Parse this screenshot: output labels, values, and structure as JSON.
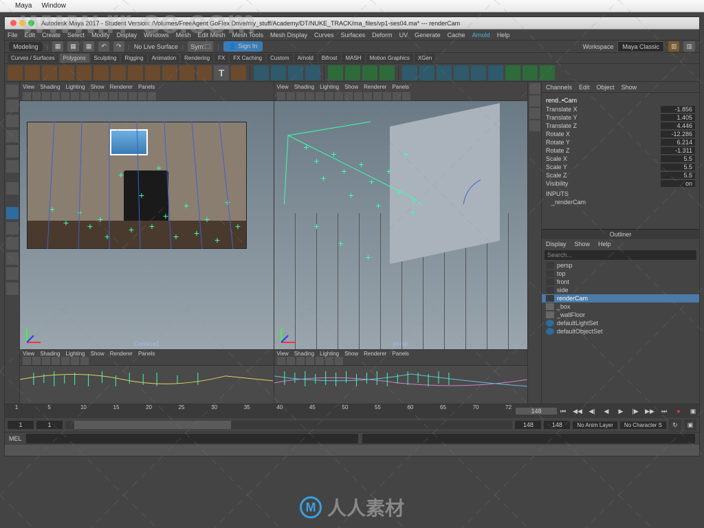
{
  "watermarks": {
    "url": "www.rr-sc.com",
    "brand": "人人素材"
  },
  "macMenu": [
    "Maya",
    "Window"
  ],
  "window": {
    "title": "Autodesk Maya 2017 - Student Version: /Volumes/FreeAgent GoFlex Drive/my_stuff/Academy/DT/NUKE_TRACK/ma_files/vp1-ses04.ma* --- renderCam"
  },
  "mainMenu": [
    "File",
    "Edit",
    "Create",
    "Select",
    "Modify",
    "Display",
    "Windows",
    "Mesh",
    "Edit Mesh",
    "Mesh Tools",
    "Mesh Display",
    "Curves",
    "Surfaces",
    "Deform",
    "UV",
    "Generate",
    "Cache",
    "Arnold",
    "Help"
  ],
  "statusLine": {
    "modeling": "Modeling",
    "noLive": "No Live Surface",
    "sym": "Sym:",
    "signIn": "Sign In",
    "workspace": "Workspace",
    "preset": "Maya Classic"
  },
  "shelfTabs": [
    "Curves / Surfaces",
    "Polygons",
    "Sculpting",
    "Rigging",
    "Animation",
    "Rendering",
    "FX",
    "FX Caching",
    "Custom",
    "Arnold",
    "Bifrost",
    "MASH",
    "Motion Graphics",
    "XGen"
  ],
  "viewportMenu": [
    "View",
    "Shading",
    "Lighting",
    "Show",
    "Renderer",
    "Panels"
  ],
  "viewLabels": {
    "v1": "Camera1",
    "v2": "persp"
  },
  "channelBox": {
    "tabs": [
      "Channels",
      "Edit",
      "Object",
      "Show"
    ],
    "objName": "rend..•Cam",
    "attrs": [
      {
        "n": "Translate X",
        "v": "-1.856"
      },
      {
        "n": "Translate Y",
        "v": "1.405"
      },
      {
        "n": "Translate Z",
        "v": "4.446"
      },
      {
        "n": "Rotate X",
        "v": "-12.286"
      },
      {
        "n": "Rotate Y",
        "v": "6.214"
      },
      {
        "n": "Rotate Z",
        "v": "-1.311"
      },
      {
        "n": "Scale X",
        "v": "5.5"
      },
      {
        "n": "Scale Y",
        "v": "5.5"
      },
      {
        "n": "Scale Z",
        "v": "5.5"
      },
      {
        "n": "Visibility",
        "v": "on"
      }
    ],
    "inputs": "INPUTS",
    "inputNode": "_renderCam"
  },
  "outliner": {
    "title": "Outliner",
    "menu": [
      "Display",
      "Show",
      "Help"
    ],
    "searchPlaceholder": "Search...",
    "items": [
      {
        "label": "persp",
        "type": "cam"
      },
      {
        "label": "top",
        "type": "cam"
      },
      {
        "label": "front",
        "type": "cam"
      },
      {
        "label": "side",
        "type": "cam"
      },
      {
        "label": "renderCam",
        "type": "cam",
        "selected": true
      },
      {
        "label": "_box",
        "type": "node"
      },
      {
        "label": "_wallFloor",
        "type": "node"
      },
      {
        "label": "defaultLightSet",
        "type": "set"
      },
      {
        "label": "defaultObjectSet",
        "type": "set"
      }
    ]
  },
  "timeline": {
    "ticks": [
      "1",
      "5",
      "10",
      "15",
      "20",
      "25",
      "30",
      "35",
      "40",
      "45",
      "50",
      "55",
      "60",
      "65",
      "70",
      "72"
    ],
    "rangeStart": "1",
    "rangeStart2": "1",
    "current": "148",
    "end1": "148",
    "end2": "148",
    "animLayer": "No Anim Layer",
    "charset": "No Character S"
  },
  "cmdLabel": "MEL",
  "colors": {
    "track": "#3dffb0",
    "select": "#4a7aa8",
    "accent": "#3a7cb5"
  }
}
